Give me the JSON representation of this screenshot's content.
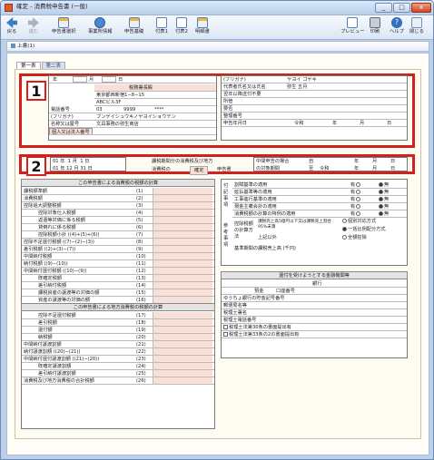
{
  "window": {
    "title": "確定 - 消費税申告書 (一般)",
    "min": "_",
    "max": "□",
    "close": "x"
  },
  "toolbar": {
    "back": "戻る",
    "fwd": "進む",
    "items": [
      "申告書選択",
      "事業所情報",
      "申告基礎",
      "付表1",
      "付表2",
      "明細書"
    ],
    "preview": "プレビュー",
    "print": "印刷",
    "help": "ヘルプ",
    "exit": "閉じる"
  },
  "breadcrumb": "上書(1)",
  "tabs": [
    "第一表",
    "第二表"
  ],
  "callouts": [
    "1",
    "2"
  ],
  "header": {
    "year_label": "年",
    "month_label": "月",
    "day_label": "日",
    "tax_office": "税務署長殿",
    "address1": "東京都西新宿1−8−15",
    "address2": "ABCビル3F",
    "tel_label": "電話番号",
    "tel1": "03",
    "tel2": "9999",
    "tel3": "****",
    "furigana_label": "(フリガナ)",
    "furigana": "ブンゲイシュウキノヤヨイショウテン",
    "name_label": "名称又は屋号",
    "name": "文具事務の弥生商店",
    "mynumber_label": "個人又は法人番号",
    "rep_furigana_label": "(フリガナ)",
    "rep_furigana": "ヤヨイ ゴヤキ",
    "rep_label": "代表者氏名又は氏名",
    "rep_name": "弥生 五月",
    "r1": "翌年以降送付不要",
    "r2": "所管",
    "r3": "要否",
    "r4": "整理番号",
    "r5": "申告年月日",
    "era": "令和"
  },
  "period": {
    "from_prefix": "01",
    "from_year": "年",
    "from_m": "1",
    "from_mlabel": "月",
    "from_d": "1",
    "from_dlabel": "日",
    "to_prefix": "01",
    "to_year": "年",
    "to_m": "12",
    "to_mlabel": "月",
    "to_d": "31",
    "to_dlabel": "日",
    "title": "課税期間分の消費税及び地方",
    "kind_label": "消費税の",
    "kind_value": "確定",
    "kind_suffix": "申告書",
    "mid_label1": "中間申告の場合",
    "mid_label2": "の対象期間",
    "mid_from": "自",
    "mid_to": "至",
    "mid_era": "令和",
    "ymd": [
      "年",
      "月",
      "日"
    ]
  },
  "calc": {
    "title": "この申告書による消費税の税額の計算",
    "rows": [
      {
        "label": "課税標準額",
        "no": "(1)"
      },
      {
        "label": "消費税額",
        "no": "(2)"
      },
      {
        "label": "控除過大調整税額",
        "no": "(3)"
      },
      {
        "label": "控除対象仕入税額",
        "no": "(4)"
      },
      {
        "label": "返還等対価に係る税額",
        "no": "(5)"
      },
      {
        "label": "貸倒れに係る税額",
        "no": "(6)"
      },
      {
        "label": "控除税額小計 ((4)+(5)+(6))",
        "no": "(7)"
      },
      {
        "label": "控除不足還付税額 ((7)−(2)−(3))",
        "no": "(8)"
      },
      {
        "label": "差引税額 ((2)+(3)−(7))",
        "no": "(9)"
      },
      {
        "label": "中間納付税額",
        "no": "(10)"
      },
      {
        "label": "納付税額 ((9)−(10))",
        "no": "(11)"
      },
      {
        "label": "中間納付還付税額 ((10)−(9))",
        "no": "(12)"
      },
      {
        "label": "既確定税額",
        "no": "(13)"
      },
      {
        "label": "差引納付税額",
        "no": "(14)"
      },
      {
        "label": "課税資産の譲渡等の対価の額",
        "no": "(15)"
      },
      {
        "label": "資産の譲渡等の対価の額",
        "no": "(16)"
      }
    ],
    "group_deduct": "控除税額",
    "group_fix": "修正申告",
    "group_sales": "課税売上割合",
    "title2": "この申告書による地方消費税の税額の計算",
    "rows2": [
      {
        "label": "控除不足還付税額",
        "no": "(17)"
      },
      {
        "label": "差引税額",
        "no": "(18)"
      },
      {
        "label": "還付額",
        "no": "(19)"
      },
      {
        "label": "納税額",
        "no": "(20)"
      },
      {
        "label": "中間納付譲渡割額",
        "no": "(21)"
      },
      {
        "label": "納付譲渡割額 ((20)−(21))",
        "no": "(22)"
      },
      {
        "label": "中間納付還付譲渡割額 ((21)−(20))",
        "no": "(23)"
      },
      {
        "label": "既確定譲渡割額",
        "no": "(24)"
      },
      {
        "label": "差引納付譲渡割額",
        "no": "(25)"
      },
      {
        "label": "消費税及び地方消費税の合計税額",
        "no": "(26)"
      }
    ],
    "group_base": "地方消費税の課税標準となる消費税額",
    "group_transfer": "譲渡割額",
    "group_fix2": "修正申告"
  },
  "notes": {
    "side1": "付記事項",
    "items": [
      "割賦基準の適用",
      "延払基準等の適用",
      "工事進行基準の適用",
      "現金主義会計の適用",
      "消費税額の計算の特例の適用"
    ],
    "yes": "有",
    "no": "無",
    "side2": "参考事項",
    "deduct_label": "控除税額の計算方法",
    "opt1": "課税売上高5億円以下又は課税売上割合95%未満",
    "opt2": "上記以外",
    "method1": "個別対応方式",
    "method2": "一括比例配分方式",
    "method3": "全額控除",
    "base_label": "基準期間の課税売上高 (千円)"
  },
  "bank": {
    "title": "還付を受けようとする金融機関等",
    "bank_label": "銀行",
    "deposit": "預金",
    "acct": "口座番号",
    "yucho": "ゆうちょ銀行の貯金記号番号",
    "post": "郵便局名等",
    "tax_sign": "税理士署名",
    "tax_tel": "税理士電話番号",
    "law30": "税理士法第30条の書面提出有",
    "law33": "税理士法第33条の2の書面提出有"
  }
}
